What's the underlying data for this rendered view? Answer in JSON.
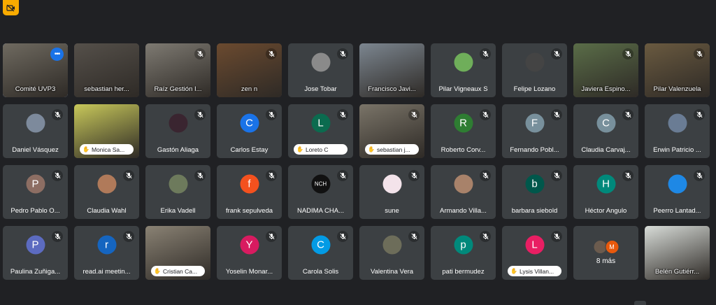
{
  "toolbar": {
    "icon": "video-off-icon",
    "accent": "#f9ab00"
  },
  "overflow_tile": {
    "label": "8 más",
    "avatars": [
      {
        "initial": "",
        "color": "#6b5b4e"
      },
      {
        "initial": "M",
        "color": "#e8590c"
      }
    ]
  },
  "participants": [
    {
      "name": "Comité UVP3",
      "kind": "video",
      "bg": "#6f6a60",
      "active": true,
      "more": true
    },
    {
      "name": "sebastian her...",
      "kind": "video",
      "bg": "#55504a"
    },
    {
      "name": "Raíz Gestión I...",
      "kind": "video",
      "bg": "#7e7a72",
      "muted": true
    },
    {
      "name": "zen n",
      "kind": "video",
      "bg": "#6b4a2f",
      "muted": true
    },
    {
      "name": "Jose Tobar",
      "kind": "avatar",
      "avatar_color": "#8a8a8a",
      "initial": "",
      "muted": true
    },
    {
      "name": "Francisco Javi...",
      "kind": "video",
      "bg": "#7c8690"
    },
    {
      "name": "Pilar Vigneaux S",
      "kind": "avatar",
      "avatar_color": "#6fae5a",
      "initial": "",
      "muted": true
    },
    {
      "name": "Felipe Lozano",
      "kind": "avatar",
      "avatar_color": "#444444",
      "initial": "",
      "muted": true
    },
    {
      "name": "Javiera Espino...",
      "kind": "video",
      "bg": "#5a6d48",
      "muted": true
    },
    {
      "name": "Pilar Valenzuela",
      "kind": "video",
      "bg": "#6a5a40",
      "muted": true
    },
    {
      "name": "Daniel Vásquez",
      "kind": "avatar",
      "avatar_color": "#7d8a9c",
      "initial": "",
      "muted": true
    },
    {
      "name": "Monica Sa...",
      "kind": "video",
      "bg": "#c8c85a",
      "pill": true
    },
    {
      "name": "Gastón Aliaga",
      "kind": "avatar",
      "avatar_color": "#3a2530",
      "initial": "",
      "muted": true
    },
    {
      "name": "Carlos Estay",
      "kind": "avatar",
      "avatar_color": "#1a73e8",
      "initial": "C",
      "muted": true
    },
    {
      "name": "Loreto C",
      "kind": "avatar",
      "avatar_color": "#0b6b4f",
      "initial": "L",
      "muted": true,
      "pill": true
    },
    {
      "name": "sebastian j...",
      "kind": "video",
      "bg": "#7a7468",
      "muted": true,
      "pill": true
    },
    {
      "name": "Roberto Corv...",
      "kind": "avatar",
      "avatar_color": "#2e7d32",
      "initial": "R",
      "muted": true
    },
    {
      "name": "Fernando Pobl...",
      "kind": "avatar",
      "avatar_color": "#78909c",
      "initial": "F",
      "muted": true
    },
    {
      "name": "Claudia Carvaj...",
      "kind": "avatar",
      "avatar_color": "#78909c",
      "initial": "C",
      "muted": true
    },
    {
      "name": "Erwin Patricio ...",
      "kind": "avatar",
      "avatar_color": "#6a7c94",
      "initial": "",
      "muted": true
    },
    {
      "name": "Pedro Pablo O...",
      "kind": "avatar",
      "avatar_color": "#8d6e63",
      "initial": "P",
      "muted": true
    },
    {
      "name": "Claudia Wahl",
      "kind": "avatar",
      "avatar_color": "#b07a5a",
      "initial": "",
      "muted": true
    },
    {
      "name": "Erika Vadell",
      "kind": "avatar",
      "avatar_color": "#6d7a5c",
      "initial": "",
      "muted": true
    },
    {
      "name": "frank sepulveda",
      "kind": "avatar",
      "avatar_color": "#f4511e",
      "initial": "f",
      "muted": true
    },
    {
      "name": "NADIMA CHA...",
      "kind": "avatar",
      "avatar_color": "#111111",
      "initial": "NCH",
      "muted": true
    },
    {
      "name": "sune",
      "kind": "avatar",
      "avatar_color": "#f3e3ea",
      "initial": "",
      "muted": true
    },
    {
      "name": "Armando Villa...",
      "kind": "avatar",
      "avatar_color": "#a8826a",
      "initial": "",
      "muted": true
    },
    {
      "name": "barbara siebold",
      "kind": "avatar",
      "avatar_color": "#00574b",
      "initial": "b",
      "muted": true
    },
    {
      "name": "Héctor Angulo",
      "kind": "avatar",
      "avatar_color": "#00897b",
      "initial": "H",
      "muted": true
    },
    {
      "name": "Peerro Lantad...",
      "kind": "avatar",
      "avatar_color": "#1e88e5",
      "initial": "",
      "muted": true
    },
    {
      "name": "Paulina Zuñiga...",
      "kind": "avatar",
      "avatar_color": "#5c6bc0",
      "initial": "P",
      "muted": true
    },
    {
      "name": "read.ai meetin...",
      "kind": "avatar",
      "avatar_color": "#1565c0",
      "initial": "r",
      "muted": true
    },
    {
      "name": "Cristian Ca...",
      "kind": "video",
      "bg": "#8a8274",
      "pill": true
    },
    {
      "name": "Yoselin Monar...",
      "kind": "avatar",
      "avatar_color": "#d81b60",
      "initial": "Y",
      "muted": true
    },
    {
      "name": "Carola Solis",
      "kind": "avatar",
      "avatar_color": "#039be5",
      "initial": "C",
      "muted": true
    },
    {
      "name": "Valentina Vera",
      "kind": "avatar",
      "avatar_color": "#6d6d5a",
      "initial": "",
      "muted": true
    },
    {
      "name": "pati bermudez",
      "kind": "avatar",
      "avatar_color": "#00897b",
      "initial": "p",
      "muted": true
    },
    {
      "name": "Lysis Villan...",
      "kind": "avatar",
      "avatar_color": "#e91e63",
      "initial": "L",
      "muted": true,
      "pill": true
    },
    {
      "name": "__overflow__",
      "kind": "overflow"
    },
    {
      "name": "Belén Gutiérr...",
      "kind": "video",
      "bg": "#d8dcd8"
    }
  ]
}
